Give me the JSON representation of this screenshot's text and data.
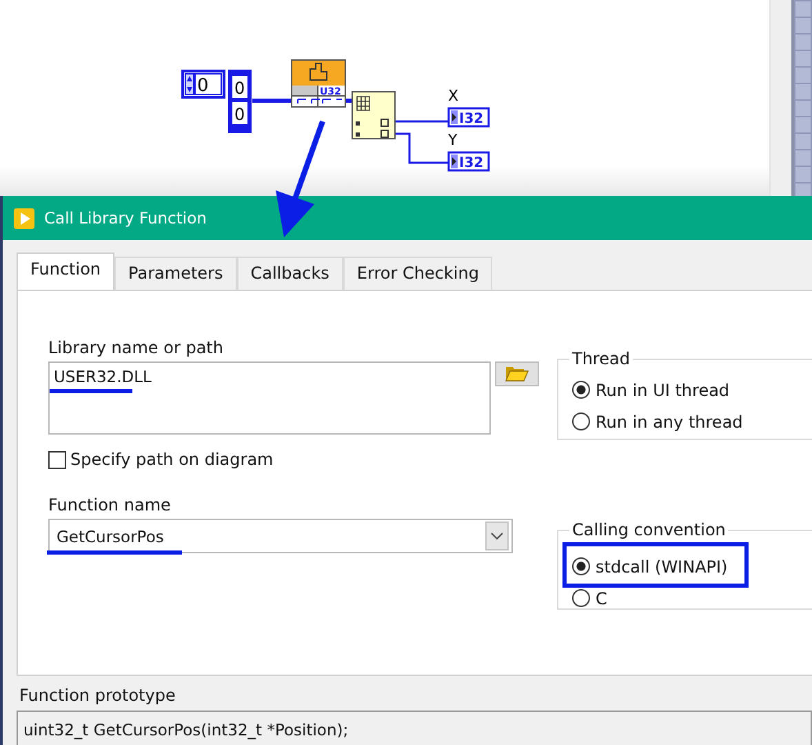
{
  "diagram": {
    "numeric_control": "0",
    "array_values": [
      "0",
      "0"
    ],
    "node_type": "U32",
    "outputs": [
      {
        "label": "X",
        "type": "I32"
      },
      {
        "label": "Y",
        "type": "I32"
      }
    ]
  },
  "dialog": {
    "title": "Call Library Function",
    "tabs": [
      {
        "label": "Function",
        "selected": true
      },
      {
        "label": "Parameters",
        "selected": false
      },
      {
        "label": "Callbacks",
        "selected": false
      },
      {
        "label": "Error Checking",
        "selected": false
      }
    ],
    "library_label": "Library name or path",
    "library_path": {
      "value": "USER32.DLL",
      "underlined": true
    },
    "specify_path": {
      "label": "Specify path on diagram",
      "checked": false
    },
    "function_label": "Function name",
    "function_name": {
      "value": "GetCursorPos",
      "underlined": true
    },
    "thread": {
      "title": "Thread",
      "options": [
        {
          "label": "Run in UI thread",
          "selected": true,
          "highlighted": false
        },
        {
          "label": "Run in any thread",
          "selected": false,
          "highlighted": false
        }
      ]
    },
    "calling_convention": {
      "title": "Calling convention",
      "options": [
        {
          "label": "stdcall (WINAPI)",
          "selected": true,
          "highlighted": true
        },
        {
          "label": "C",
          "selected": false,
          "highlighted": false
        }
      ]
    },
    "prototype_label": "Function prototype",
    "prototype": "uint32_t GetCursorPos(int32_t *Position);"
  }
}
